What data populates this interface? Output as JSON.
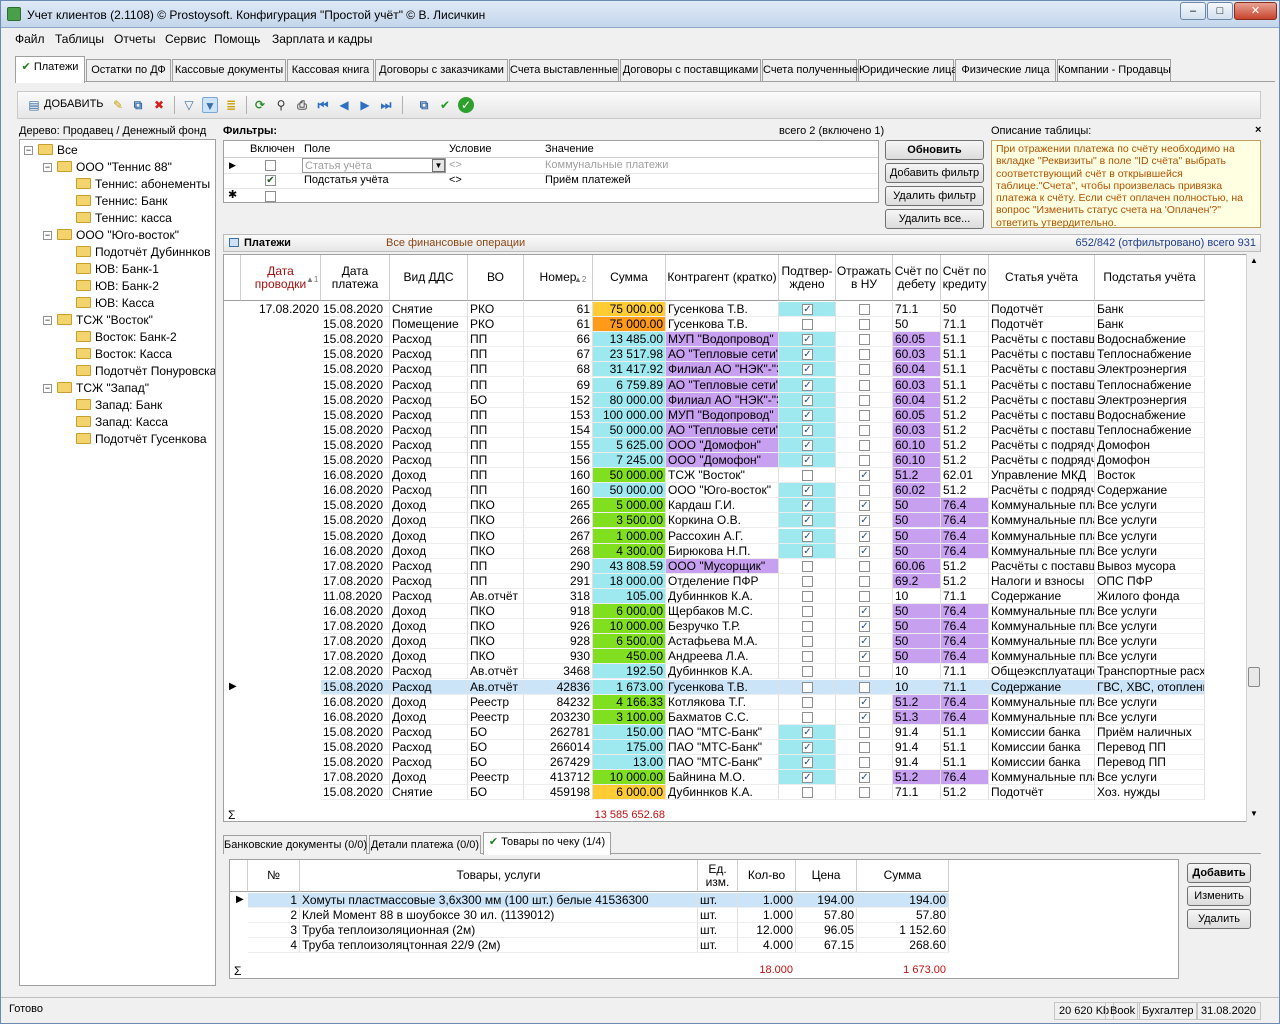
{
  "window": {
    "title": "Учет клиентов (2.1108) © Prostoysoft. Конфигурация \"Простой учёт\" © В. Лисичкин"
  },
  "menu": [
    "Файл",
    "Таблицы",
    "Отчеты",
    "Сервис",
    "Помощь",
    "Зарплата и кадры"
  ],
  "tabs": [
    "Платежи",
    "Остатки по ДФ",
    "Кассовые документы",
    "Кассовая книга",
    "Договоры с заказчиками",
    "Счета выставленные",
    "Договоры с поставщиками",
    "Счета полученные",
    "Юридические лица",
    "Физические лица",
    "Компании - Продавцы"
  ],
  "toolbar": {
    "add_label": "ДОБАВИТЬ"
  },
  "tree": {
    "header": "Дерево: Продавец / Денежный фонд",
    "nodes": [
      {
        "label": "Все",
        "level": 0,
        "toggle": "−"
      },
      {
        "label": "ООО \"Теннис 88\"",
        "level": 1,
        "toggle": "−"
      },
      {
        "label": "Теннис: абонементы",
        "level": 2,
        "toggle": ""
      },
      {
        "label": "Теннис: Банк",
        "level": 2,
        "toggle": ""
      },
      {
        "label": "Теннис: касса",
        "level": 2,
        "toggle": ""
      },
      {
        "label": "ООО \"Юго-восток\"",
        "level": 1,
        "toggle": "−"
      },
      {
        "label": "Подотчёт Дубиннков",
        "level": 2,
        "toggle": ""
      },
      {
        "label": "ЮВ: Банк-1",
        "level": 2,
        "toggle": ""
      },
      {
        "label": "ЮВ: Банк-2",
        "level": 2,
        "toggle": ""
      },
      {
        "label": "ЮВ: Касса",
        "level": 2,
        "toggle": ""
      },
      {
        "label": "ТСЖ \"Восток\"",
        "level": 1,
        "toggle": "−"
      },
      {
        "label": "Восток: Банк-2",
        "level": 2,
        "toggle": ""
      },
      {
        "label": "Восток: Касса",
        "level": 2,
        "toggle": ""
      },
      {
        "label": "Подотчёт Понуровская",
        "level": 2,
        "toggle": ""
      },
      {
        "label": "ТСЖ \"Запад\"",
        "level": 1,
        "toggle": "−"
      },
      {
        "label": "Запад: Банк",
        "level": 2,
        "toggle": ""
      },
      {
        "label": "Запад: Касса",
        "level": 2,
        "toggle": ""
      },
      {
        "label": "Подотчёт Гусенкова",
        "level": 2,
        "toggle": ""
      }
    ]
  },
  "filters": {
    "label": "Фильтры:",
    "count": "всего 2 (включено 1)",
    "headers": [
      "Включен",
      "Поле",
      "Условие",
      "Значение"
    ],
    "rows": [
      {
        "enabled": false,
        "field": "Статья учёта",
        "cond": "<>",
        "value": "Коммунальные платежи",
        "grey": true
      },
      {
        "enabled": true,
        "field": "Подстатья учёта",
        "cond": "<>",
        "value": "Приём платежей",
        "grey": false
      }
    ],
    "buttons": [
      "Обновить",
      "Добавить фильтр",
      "Удалить фильтр",
      "Удалить все..."
    ]
  },
  "description": {
    "label": "Описание таблицы:",
    "text": "При отражении платежа по счёту необходимо на вкладке \"Реквизиты\" в поле \"ID счёта\" выбрать соответствующий счёт в открывшейся таблице.\"Счета\", чтобы произвелась привязка платежа к счёту. Если счёт оплачен полностью, на вопрос \"Изменить статус счета на 'Оплачен'?\" ответить утвердительно."
  },
  "payments": {
    "title": "Платежи",
    "subtitle": "Все финансовые операции",
    "counter": "652/842 (отфильтровано) всего 931",
    "headers": [
      "Дата проводки",
      "Дата платежа",
      "Вид ДДС",
      "ВО",
      "Номер",
      "Сумма",
      "Контрагент (кратко)",
      "Подтвер-ждено",
      "Отражать в НУ",
      "Счёт по дебету",
      "Счёт по кредиту",
      "Статья учёта",
      "Подстатья учёта"
    ],
    "group_date": "17.08.2020",
    "total": "13 585 652.68",
    "rows": [
      [
        "15.08.2020",
        "Снятие",
        "РКО",
        "61",
        "75 000.00",
        "Гусенкова Т.В.",
        true,
        false,
        "71.1",
        "50",
        "Подотчёт",
        "Банк"
      ],
      [
        "15.08.2020",
        "Помещение",
        "РКО",
        "61",
        "75 000.00",
        "Гусенкова Т.В.",
        false,
        false,
        "50",
        "71.1",
        "Подотчёт",
        "Банк"
      ],
      [
        "15.08.2020",
        "Расход",
        "ПП",
        "66",
        "13 485.00",
        "МУП \"Водопровод\"",
        true,
        false,
        "60.05",
        "51.1",
        "Расчёты с поставщ",
        "Водоснабжение"
      ],
      [
        "15.08.2020",
        "Расход",
        "ПП",
        "67",
        "23 517.98",
        "АО \"Тепловые сети\"",
        true,
        false,
        "60.03",
        "51.1",
        "Расчёты с поставщ",
        "Теплоснабжение"
      ],
      [
        "15.08.2020",
        "Расход",
        "ПП",
        "68",
        "31 417.92",
        "Филиал АО \"НЭК\"-\"Эн",
        true,
        false,
        "60.04",
        "51.1",
        "Расчёты с поставщ",
        "Электроэнергия"
      ],
      [
        "15.08.2020",
        "Расход",
        "ПП",
        "69",
        "6 759.89",
        "АО \"Тепловые сети\"",
        true,
        false,
        "60.03",
        "51.1",
        "Расчёты с поставщ",
        "Теплоснабжение"
      ],
      [
        "15.08.2020",
        "Расход",
        "БО",
        "152",
        "80 000.00",
        "Филиал АО \"НЭК\"-\"Эн",
        true,
        false,
        "60.04",
        "51.2",
        "Расчёты с поставщ",
        "Электроэнергия"
      ],
      [
        "15.08.2020",
        "Расход",
        "ПП",
        "153",
        "100 000.00",
        "МУП \"Водопровод\"",
        true,
        false,
        "60.05",
        "51.2",
        "Расчёты с поставщ",
        "Водоснабжение"
      ],
      [
        "15.08.2020",
        "Расход",
        "ПП",
        "154",
        "50 000.00",
        "АО \"Тепловые сети\"",
        true,
        false,
        "60.03",
        "51.2",
        "Расчёты с поставщ",
        "Теплоснабжение"
      ],
      [
        "15.08.2020",
        "Расход",
        "ПП",
        "155",
        "5 625.00",
        "ООО \"Домофон\"",
        true,
        false,
        "60.10",
        "51.2",
        "Расчёты с подрядч",
        "Домофон"
      ],
      [
        "15.08.2020",
        "Расход",
        "ПП",
        "156",
        "7 245.00",
        "ООО \"Домофон\"",
        true,
        false,
        "60.10",
        "51.2",
        "Расчёты с подрядч",
        "Домофон"
      ],
      [
        "16.08.2020",
        "Доход",
        "ПП",
        "160",
        "50 000.00",
        "ТСЖ \"Восток\"",
        false,
        true,
        "51.2",
        "62.01",
        "Управление МКД",
        "Восток"
      ],
      [
        "16.08.2020",
        "Расход",
        "ПП",
        "160",
        "50 000.00",
        "ООО \"Юго-восток\"",
        true,
        false,
        "60.02",
        "51.2",
        "Расчёты с подрядч",
        "Содержание"
      ],
      [
        "15.08.2020",
        "Доход",
        "ПКО",
        "265",
        "5 000.00",
        "Кардаш Г.И.",
        true,
        true,
        "50",
        "76.4",
        "Коммунальные пла",
        "Все услуги"
      ],
      [
        "15.08.2020",
        "Доход",
        "ПКО",
        "266",
        "3 500.00",
        "Коркина О.В.",
        true,
        true,
        "50",
        "76.4",
        "Коммунальные пла",
        "Все услуги"
      ],
      [
        "15.08.2020",
        "Доход",
        "ПКО",
        "267",
        "1 000.00",
        "Рассохин А.Г.",
        true,
        true,
        "50",
        "76.4",
        "Коммунальные пла",
        "Все услуги"
      ],
      [
        "16.08.2020",
        "Доход",
        "ПКО",
        "268",
        "4 300.00",
        "Бирюкова Н.П.",
        true,
        true,
        "50",
        "76.4",
        "Коммунальные пла",
        "Все услуги"
      ],
      [
        "17.08.2020",
        "Расход",
        "ПП",
        "290",
        "43 808.59",
        "ООО \"Мусорщик\"",
        false,
        false,
        "60.06",
        "51.2",
        "Расчёты с поставщ",
        "Вывоз мусора"
      ],
      [
        "17.08.2020",
        "Расход",
        "ПП",
        "291",
        "18 000.00",
        "Отделение ПФР",
        false,
        false,
        "69.2",
        "51.2",
        "Налоги и взносы",
        "ОПС ПФР"
      ],
      [
        "11.08.2020",
        "Расход",
        "Ав.отчёт",
        "318",
        "105.00",
        "Дубиннков К.А.",
        false,
        false,
        "10",
        "71.1",
        "Содержание",
        "Жилого фонда"
      ],
      [
        "16.08.2020",
        "Доход",
        "ПКО",
        "918",
        "6 000.00",
        "Щербаков М.С.",
        false,
        true,
        "50",
        "76.4",
        "Коммунальные пла",
        "Все услуги"
      ],
      [
        "17.08.2020",
        "Доход",
        "ПКО",
        "926",
        "10 000.00",
        "Безручко Т.Р.",
        false,
        true,
        "50",
        "76.4",
        "Коммунальные пла",
        "Все услуги"
      ],
      [
        "17.08.2020",
        "Доход",
        "ПКО",
        "928",
        "6 500.00",
        "Астафьева М.А.",
        false,
        true,
        "50",
        "76.4",
        "Коммунальные пла",
        "Все услуги"
      ],
      [
        "17.08.2020",
        "Доход",
        "ПКО",
        "930",
        "450.00",
        "Андреева Л.А.",
        false,
        true,
        "50",
        "76.4",
        "Коммунальные пла",
        "Все услуги"
      ],
      [
        "12.08.2020",
        "Расход",
        "Ав.отчёт",
        "3468",
        "192.50",
        "Дубиннков К.А.",
        false,
        false,
        "10",
        "71.1",
        "Общеэксплуатацио",
        "Транспортные расх"
      ],
      [
        "15.08.2020",
        "Расход",
        "Ав.отчёт",
        "42836",
        "1 673.00",
        "Гусенкова Т.В.",
        false,
        false,
        "10",
        "71.1",
        "Содержание",
        "ГВС, ХВС, отоплени"
      ],
      [
        "16.08.2020",
        "Доход",
        "Реестр",
        "84232",
        "4 166.33",
        "Котлякова Т.Г.",
        false,
        true,
        "51.2",
        "76.4",
        "Коммунальные пла",
        "Все услуги"
      ],
      [
        "16.08.2020",
        "Доход",
        "Реестр",
        "203230",
        "3 100.00",
        "Бахматов С.С.",
        false,
        true,
        "51.3",
        "76.4",
        "Коммунальные пла",
        "Все услуги"
      ],
      [
        "15.08.2020",
        "Расход",
        "БО",
        "262781",
        "150.00",
        "ПАО \"МТС-Банк\"",
        true,
        false,
        "91.4",
        "51.1",
        "Комиссии банка",
        "Приём наличных"
      ],
      [
        "15.08.2020",
        "Расход",
        "БО",
        "266014",
        "175.00",
        "ПАО \"МТС-Банк\"",
        true,
        false,
        "91.4",
        "51.1",
        "Комиссии банка",
        "Перевод ПП"
      ],
      [
        "15.08.2020",
        "Расход",
        "БО",
        "267429",
        "13.00",
        "ПАО \"МТС-Банк\"",
        true,
        false,
        "91.4",
        "51.1",
        "Комиссии банка",
        "Перевод ПП"
      ],
      [
        "17.08.2020",
        "Доход",
        "Реестр",
        "413712",
        "10 000.00",
        "Байнина М.О.",
        true,
        true,
        "51.2",
        "76.4",
        "Коммунальные пла",
        "Все услуги"
      ],
      [
        "15.08.2020",
        "Снятие",
        "БО",
        "459198",
        "6 000.00",
        "Дубиннков К.А.",
        false,
        false,
        "71.1",
        "51.2",
        "Подотчёт",
        "Хоз. нужды"
      ]
    ],
    "sum_colors": [
      "#ffcc33",
      "#ff9a1a",
      "#9ee8f0",
      "#9ee8f0",
      "#9ee8f0",
      "#9ee8f0",
      "#9ee8f0",
      "#9ee8f0",
      "#9ee8f0",
      "#9ee8f0",
      "#9ee8f0",
      "#80e020",
      "#9ee8f0",
      "#80e020",
      "#80e020",
      "#80e020",
      "#80e020",
      "#9ee8f0",
      "#9ee8f0",
      "#9ee8f0",
      "#80e020",
      "#80e020",
      "#80e020",
      "#80e020",
      "#9ee8f0",
      "#9ee8f0",
      "#80e020",
      "#80e020",
      "#9ee8f0",
      "#9ee8f0",
      "#9ee8f0",
      "#80e020",
      "#ffcc33"
    ],
    "selected_row": 25
  },
  "bottom_tabs": [
    "Банковские документы (0/0)",
    "Детали платежа (0/0)",
    "Товары по чеку (1/4)"
  ],
  "goods": {
    "headers": [
      "№",
      "Товары, услуги",
      "Ед. изм.",
      "Кол-во",
      "Цена",
      "Сумма"
    ],
    "rows": [
      [
        "1",
        "Хомуты пластмассовые 3,6х300 мм (100 шт.) белые 41536300",
        "шт.",
        "1.000",
        "194.00",
        "194.00"
      ],
      [
        "2",
        "Клей Момент 88 в шоубоксе 30 ил. (1139012)",
        "шт.",
        "1.000",
        "57.80",
        "57.80"
      ],
      [
        "3",
        "Труба теплоизоляционная (2м)",
        "шт.",
        "12.000",
        "96.05",
        "1 152.60"
      ],
      [
        "4",
        "Труба теплоизоляцтонная 22/9 (2м)",
        "шт.",
        "4.000",
        "67.15",
        "268.60"
      ]
    ],
    "total_qty": "18.000",
    "total_sum": "1 673.00",
    "buttons": [
      "Добавить",
      "Изменить",
      "Удалить"
    ]
  },
  "status": {
    "left": "Готово",
    "mem": "20 620 Kb",
    "mode": "Book",
    "user": "Бухгалтер",
    "date": "31.08.2020"
  }
}
